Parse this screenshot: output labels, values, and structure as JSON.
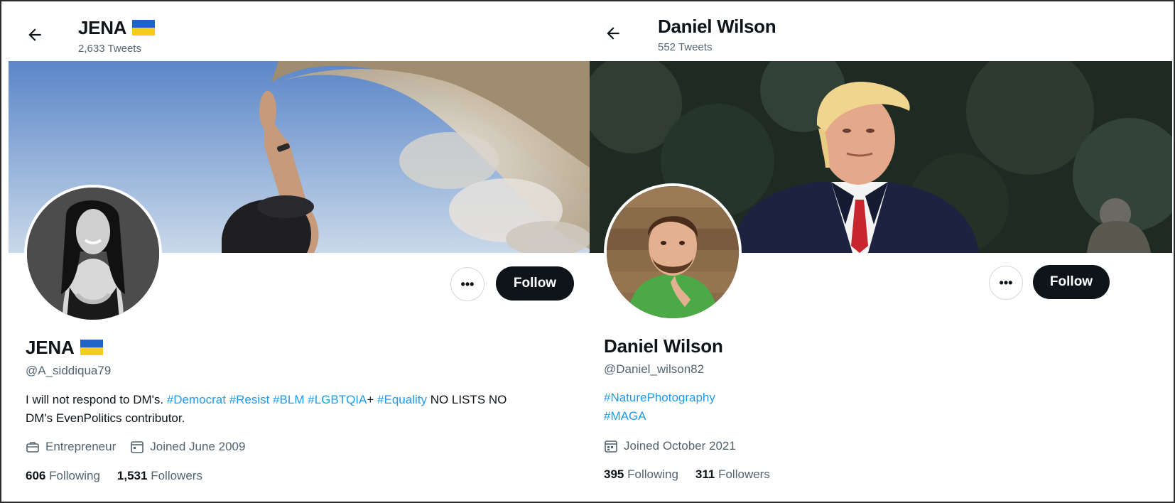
{
  "left": {
    "header_name": "JENA",
    "header_tweets": "2,633 Tweets",
    "name": "JENA",
    "handle": "@A_siddiqua79",
    "bio_plain_1": "I will not respond to DM's. ",
    "bio_tags_1": "#Democrat #Resist #BLM #LGBTQIA",
    "bio_plain_2": "+ ",
    "bio_tags_2": "#Equality",
    "bio_plain_3": " NO LISTS NO DM's EvenPolitics contributor.",
    "profession": "Entrepreneur",
    "joined": "Joined June 2009",
    "following_count": "606",
    "following_label": "Following",
    "followers_count": "1,531",
    "followers_label": "Followers",
    "more_label": "•••",
    "follow_label": "Follow",
    "flag_colors": {
      "top": "#1f63c6",
      "bottom": "#f6cd1c"
    }
  },
  "right": {
    "header_name": "Daniel Wilson",
    "header_tweets": "552 Tweets",
    "name": "Daniel Wilson",
    "handle": "@Daniel_wilson82",
    "bio_tag_1": "#NaturePhotography",
    "bio_tag_2": "#MAGA",
    "joined": "Joined October 2021",
    "following_count": "395",
    "following_label": "Following",
    "followers_count": "311",
    "followers_label": "Followers",
    "more_label": "•••",
    "follow_label": "Follow"
  },
  "icons": {
    "back": "back-arrow-icon",
    "profession": "briefcase-icon",
    "calendar": "calendar-icon"
  },
  "colors": {
    "link": "#1d9bf0",
    "secondary_text": "#536471",
    "follow_bg": "#0f1419"
  }
}
